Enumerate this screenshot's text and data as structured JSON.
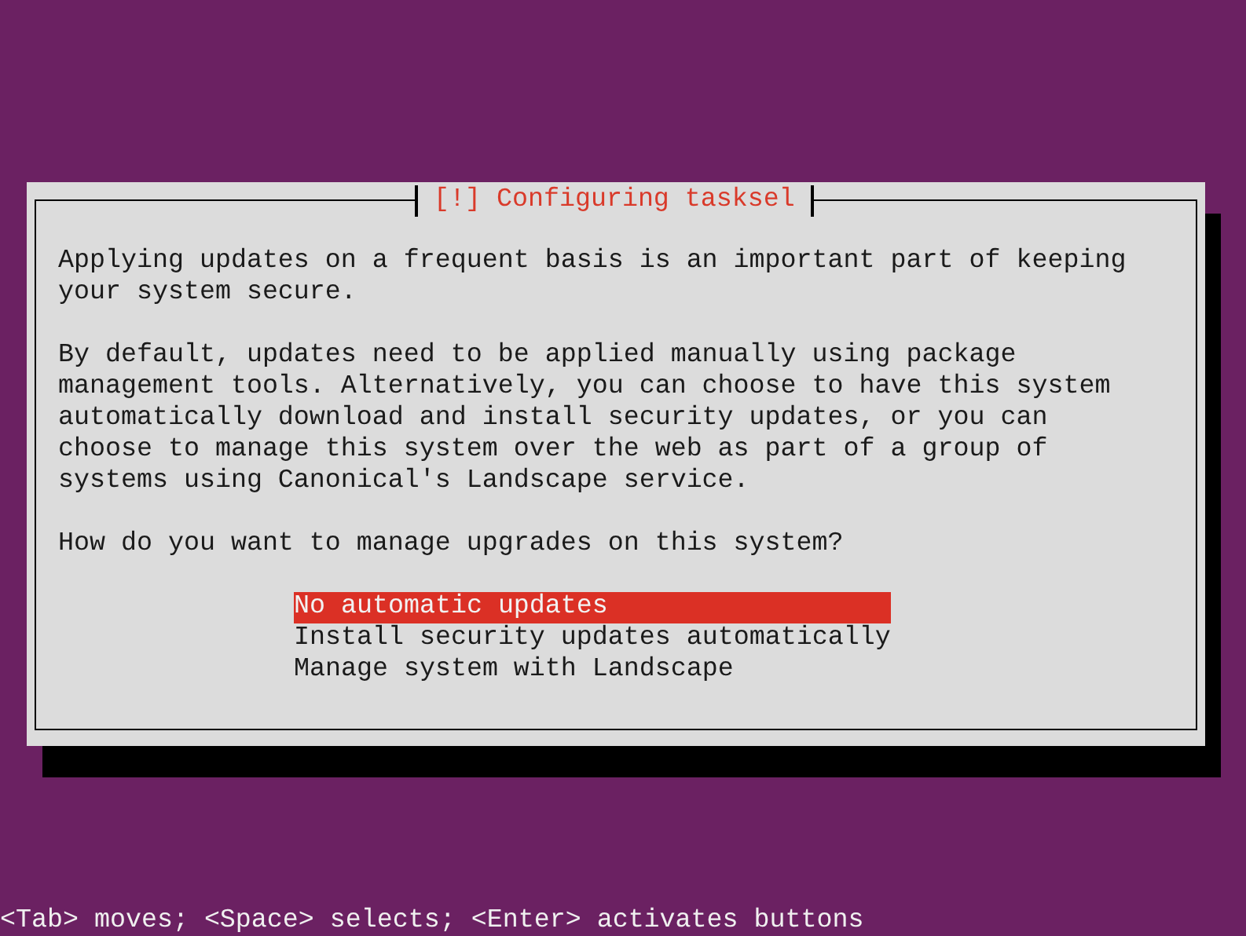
{
  "dialog": {
    "title": "[!] Configuring tasksel",
    "paragraphs": [
      "Applying updates on a frequent basis is an important part of keeping your system secure.",
      "By default, updates need to be applied manually using package management tools. Alternatively, you can choose to have this system automatically download and install security updates, or you can choose to manage this system over the web as part of a group of systems using Canonical's Landscape service."
    ],
    "question": "How do you want to manage upgrades on this system?",
    "options": [
      {
        "label": "No automatic updates",
        "selected": true
      },
      {
        "label": "Install security updates automatically",
        "selected": false
      },
      {
        "label": "Manage system with Landscape",
        "selected": false
      }
    ]
  },
  "status_bar": "<Tab> moves; <Space> selects; <Enter> activates buttons"
}
